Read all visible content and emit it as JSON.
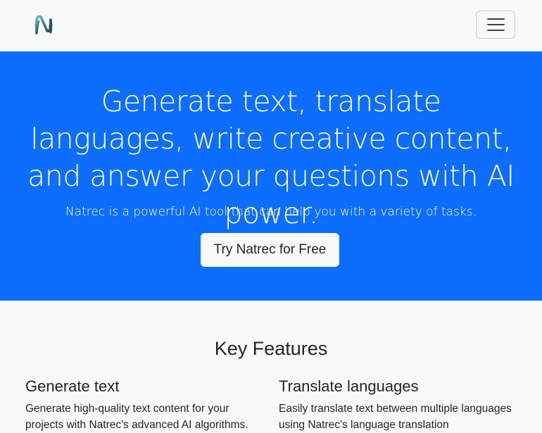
{
  "navbar": {
    "brand_logo_icon": "natrec-n-logo-icon",
    "menu_icon": "hamburger-menu-icon"
  },
  "hero": {
    "title": "Generate text, translate languages, write creative content, and answer your questions with AI power.",
    "lead": "Natrec is a powerful AI tool that can help you with a variety of tasks.",
    "cta_label": "Try Natrec for Free",
    "background_color": "#0d6efd"
  },
  "features": {
    "title": "Key Features",
    "items": [
      {
        "title": "Generate text",
        "description": "Generate high-quality text content for your projects with Natrec's advanced AI algorithms."
      },
      {
        "title": "Translate languages",
        "description": "Easily translate text between multiple languages using Natrec's language translation"
      }
    ]
  }
}
